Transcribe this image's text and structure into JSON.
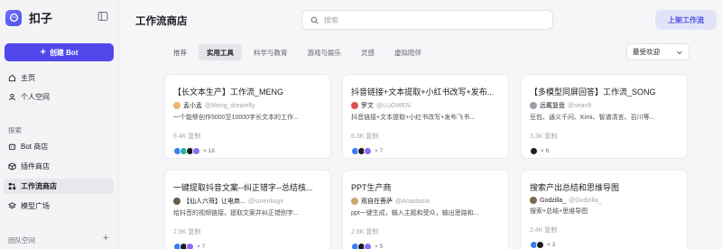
{
  "brand": {
    "name": "扣子"
  },
  "sidebar": {
    "create_label": "创建 Bot",
    "items": [
      {
        "label": "主页",
        "icon": "home-icon"
      },
      {
        "label": "个人空间",
        "icon": "user-icon"
      }
    ],
    "section_explore": "探索",
    "explore_items": [
      {
        "label": "Bot 商店",
        "icon": "bot-store-icon"
      },
      {
        "label": "插件商店",
        "icon": "plugin-icon"
      },
      {
        "label": "工作流商店",
        "icon": "workflow-icon",
        "active": true
      },
      {
        "label": "模型广场",
        "icon": "model-icon"
      }
    ],
    "section_team": "团队空间"
  },
  "header": {
    "title": "工作流商店",
    "search_placeholder": "搜索",
    "publish_label": "上架工作流"
  },
  "tabs": [
    {
      "label": "推荐"
    },
    {
      "label": "实用工具",
      "active": true
    },
    {
      "label": "科学与教育"
    },
    {
      "label": "游戏与娱乐"
    },
    {
      "label": "灵感"
    },
    {
      "label": "虚拟陪伴"
    }
  ],
  "sort": {
    "value": "最受欢迎"
  },
  "cards": [
    {
      "title": "【长文本生产】工作流_MENG",
      "author": "孟小孟",
      "handle": "@Meng_dreamfly",
      "desc": "一个能够创作5000至10000字长文本的工作...",
      "copies": "6.4K 复制",
      "models": "× 18",
      "avatar_color": "#f0b46a"
    },
    {
      "title": "抖音链接+文本提取+小红书改写+发布...",
      "author": "罗文",
      "handle": "@LUOWEN",
      "desc": "抖音链接+文本提取+小红书改写+发布飞书...",
      "copies": "6.3K 复制",
      "models": "× 7",
      "avatar_color": "#d9534f"
    },
    {
      "title": "【多模型同屏回答】工作流_SONG",
      "author": "远戴复盘",
      "handle": "@sean9",
      "desc": "豆包、通义千问、Kimi、智谱清言、百川等...",
      "copies": "3.3K 复制",
      "models": "× 6",
      "avatar_color": "#9aa0a8"
    },
    {
      "title": "一键提取抖音文案--纠正错字--总结核...",
      "author": "【仙人六哥】让电商...",
      "handle": "@surenliuge",
      "desc": "给抖音的视频链接，提取文案并纠正错别字...",
      "copies": "2.9K 复制",
      "models": "× 7",
      "avatar_color": "#6b5b4b"
    },
    {
      "title": "PPT生产商",
      "author": "观自在菩萨",
      "handle": "@Anastasia",
      "desc": "ppt一键生成，输入主题和受众，输出思路和...",
      "copies": "2.6K 复制",
      "models": "× 5",
      "avatar_color": "#c9a66b"
    },
    {
      "title": "搜索产出总结和思维导图",
      "author": "Godzilla_",
      "handle": "@Godzilla_",
      "desc": "搜索+总结+思维导图",
      "copies": "2.4K 复制",
      "models": "× 3",
      "avatar_color": "#7a6a4a"
    }
  ],
  "colors": {
    "accent": "#5148ec",
    "active_bg": "#e7e7ec"
  }
}
